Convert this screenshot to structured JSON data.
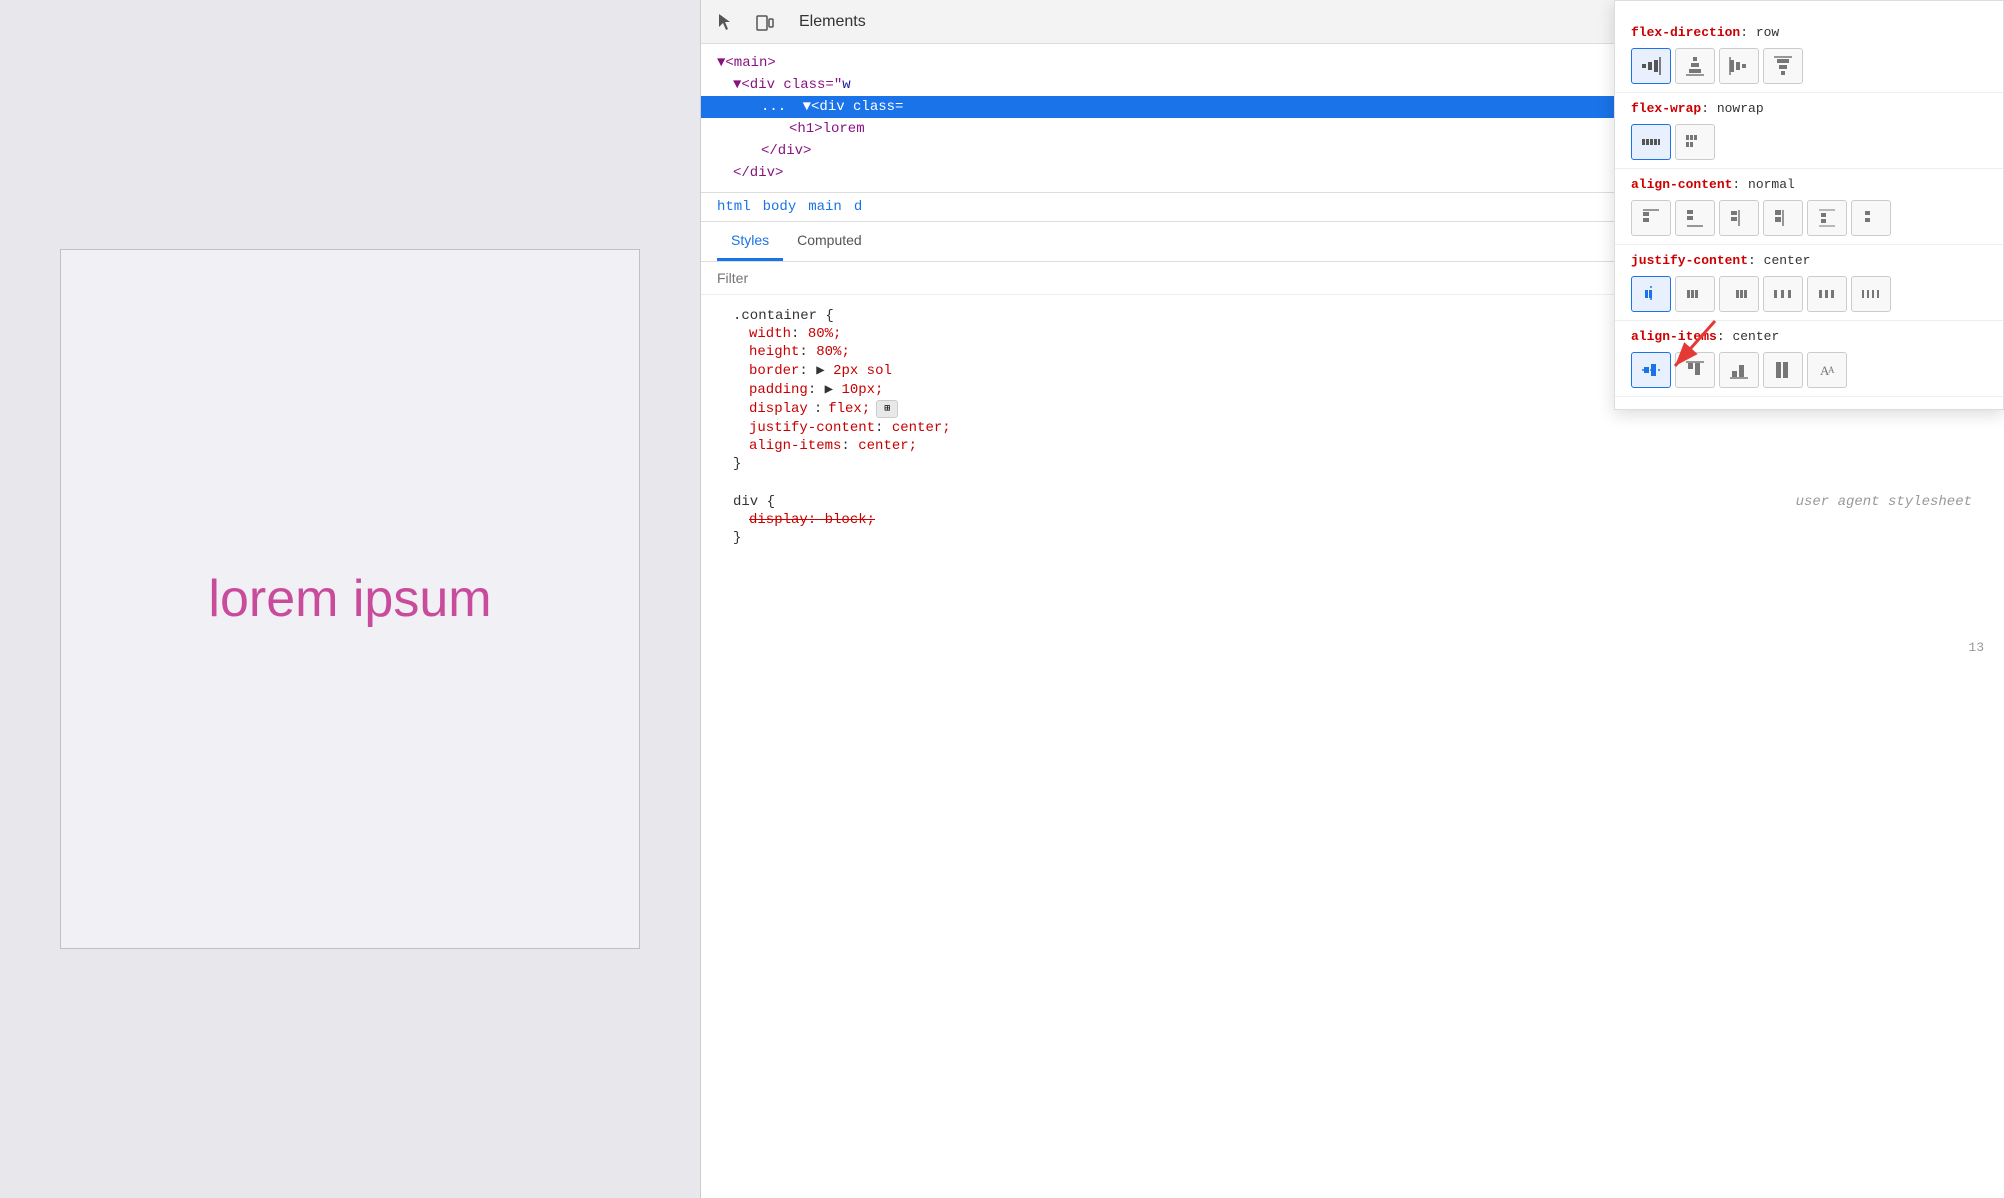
{
  "preview": {
    "lorem_text": "lorem ipsum"
  },
  "devtools": {
    "header": {
      "tab_elements": "Elements"
    },
    "tree": {
      "lines": [
        {
          "text": "▼<main>",
          "indent": 0,
          "selected": false
        },
        {
          "text": "  ▼<div class=\"w",
          "indent": 1,
          "selected": false
        },
        {
          "text": "      ▼<div class=",
          "indent": 2,
          "selected": true
        },
        {
          "text": "          <h1>lorem",
          "indent": 3,
          "selected": false
        },
        {
          "text": "      </div>",
          "indent": 2,
          "selected": false
        },
        {
          "text": "  </div>",
          "indent": 1,
          "selected": false
        }
      ]
    },
    "breadcrumb": {
      "items": [
        "html",
        "body",
        "main",
        "d"
      ]
    },
    "tabs": {
      "styles_label": "Styles",
      "computed_label": "Computed"
    },
    "filter": {
      "placeholder": "Filter"
    },
    "css_rules": {
      "container_selector": ".container {",
      "container_props": [
        {
          "name": "width",
          "value": "80%;"
        },
        {
          "name": "height",
          "value": "80%;"
        },
        {
          "name": "border",
          "value": "▶ 2px sol"
        },
        {
          "name": "padding",
          "value": "▶ 10px;"
        },
        {
          "name": "display",
          "value": "flex;"
        },
        {
          "name": "justify-content",
          "value": "center;"
        },
        {
          "name": "align-items",
          "value": "center;"
        }
      ],
      "div_selector": "div {",
      "div_comment": "user agent stylesheet",
      "div_props": [
        {
          "name": "display: block;",
          "strikethrough": true
        }
      ],
      "closing": "}"
    },
    "flex_tooltip": {
      "flex_direction": {
        "label": "flex-direction",
        "value": "row"
      },
      "flex_wrap": {
        "label": "flex-wrap",
        "value": "nowrap"
      },
      "align_content": {
        "label": "align-content",
        "value": "normal"
      },
      "justify_content": {
        "label": "justify-content",
        "value": "center"
      },
      "align_items": {
        "label": "align-items",
        "value": "center"
      }
    },
    "line_number": "13"
  }
}
